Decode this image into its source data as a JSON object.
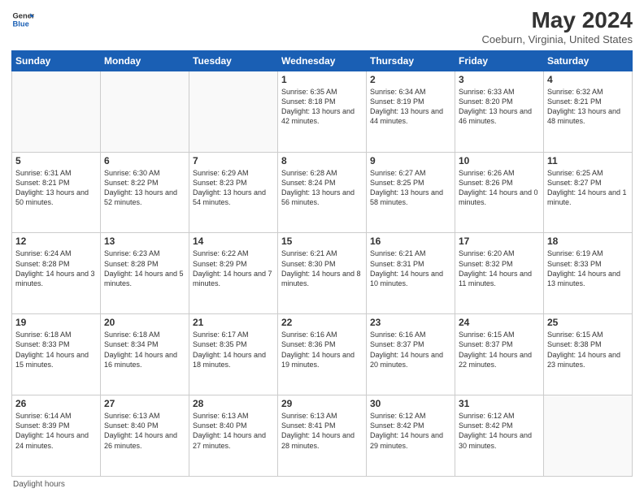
{
  "header": {
    "logo_general": "General",
    "logo_blue": "Blue",
    "title": "May 2024",
    "subtitle": "Coeburn, Virginia, United States"
  },
  "weekdays": [
    "Sunday",
    "Monday",
    "Tuesday",
    "Wednesday",
    "Thursday",
    "Friday",
    "Saturday"
  ],
  "weeks": [
    [
      {
        "day": "",
        "info": ""
      },
      {
        "day": "",
        "info": ""
      },
      {
        "day": "",
        "info": ""
      },
      {
        "day": "1",
        "info": "Sunrise: 6:35 AM\nSunset: 8:18 PM\nDaylight: 13 hours\nand 42 minutes."
      },
      {
        "day": "2",
        "info": "Sunrise: 6:34 AM\nSunset: 8:19 PM\nDaylight: 13 hours\nand 44 minutes."
      },
      {
        "day": "3",
        "info": "Sunrise: 6:33 AM\nSunset: 8:20 PM\nDaylight: 13 hours\nand 46 minutes."
      },
      {
        "day": "4",
        "info": "Sunrise: 6:32 AM\nSunset: 8:21 PM\nDaylight: 13 hours\nand 48 minutes."
      }
    ],
    [
      {
        "day": "5",
        "info": "Sunrise: 6:31 AM\nSunset: 8:21 PM\nDaylight: 13 hours\nand 50 minutes."
      },
      {
        "day": "6",
        "info": "Sunrise: 6:30 AM\nSunset: 8:22 PM\nDaylight: 13 hours\nand 52 minutes."
      },
      {
        "day": "7",
        "info": "Sunrise: 6:29 AM\nSunset: 8:23 PM\nDaylight: 13 hours\nand 54 minutes."
      },
      {
        "day": "8",
        "info": "Sunrise: 6:28 AM\nSunset: 8:24 PM\nDaylight: 13 hours\nand 56 minutes."
      },
      {
        "day": "9",
        "info": "Sunrise: 6:27 AM\nSunset: 8:25 PM\nDaylight: 13 hours\nand 58 minutes."
      },
      {
        "day": "10",
        "info": "Sunrise: 6:26 AM\nSunset: 8:26 PM\nDaylight: 14 hours\nand 0 minutes."
      },
      {
        "day": "11",
        "info": "Sunrise: 6:25 AM\nSunset: 8:27 PM\nDaylight: 14 hours\nand 1 minute."
      }
    ],
    [
      {
        "day": "12",
        "info": "Sunrise: 6:24 AM\nSunset: 8:28 PM\nDaylight: 14 hours\nand 3 minutes."
      },
      {
        "day": "13",
        "info": "Sunrise: 6:23 AM\nSunset: 8:28 PM\nDaylight: 14 hours\nand 5 minutes."
      },
      {
        "day": "14",
        "info": "Sunrise: 6:22 AM\nSunset: 8:29 PM\nDaylight: 14 hours\nand 7 minutes."
      },
      {
        "day": "15",
        "info": "Sunrise: 6:21 AM\nSunset: 8:30 PM\nDaylight: 14 hours\nand 8 minutes."
      },
      {
        "day": "16",
        "info": "Sunrise: 6:21 AM\nSunset: 8:31 PM\nDaylight: 14 hours\nand 10 minutes."
      },
      {
        "day": "17",
        "info": "Sunrise: 6:20 AM\nSunset: 8:32 PM\nDaylight: 14 hours\nand 11 minutes."
      },
      {
        "day": "18",
        "info": "Sunrise: 6:19 AM\nSunset: 8:33 PM\nDaylight: 14 hours\nand 13 minutes."
      }
    ],
    [
      {
        "day": "19",
        "info": "Sunrise: 6:18 AM\nSunset: 8:33 PM\nDaylight: 14 hours\nand 15 minutes."
      },
      {
        "day": "20",
        "info": "Sunrise: 6:18 AM\nSunset: 8:34 PM\nDaylight: 14 hours\nand 16 minutes."
      },
      {
        "day": "21",
        "info": "Sunrise: 6:17 AM\nSunset: 8:35 PM\nDaylight: 14 hours\nand 18 minutes."
      },
      {
        "day": "22",
        "info": "Sunrise: 6:16 AM\nSunset: 8:36 PM\nDaylight: 14 hours\nand 19 minutes."
      },
      {
        "day": "23",
        "info": "Sunrise: 6:16 AM\nSunset: 8:37 PM\nDaylight: 14 hours\nand 20 minutes."
      },
      {
        "day": "24",
        "info": "Sunrise: 6:15 AM\nSunset: 8:37 PM\nDaylight: 14 hours\nand 22 minutes."
      },
      {
        "day": "25",
        "info": "Sunrise: 6:15 AM\nSunset: 8:38 PM\nDaylight: 14 hours\nand 23 minutes."
      }
    ],
    [
      {
        "day": "26",
        "info": "Sunrise: 6:14 AM\nSunset: 8:39 PM\nDaylight: 14 hours\nand 24 minutes."
      },
      {
        "day": "27",
        "info": "Sunrise: 6:13 AM\nSunset: 8:40 PM\nDaylight: 14 hours\nand 26 minutes."
      },
      {
        "day": "28",
        "info": "Sunrise: 6:13 AM\nSunset: 8:40 PM\nDaylight: 14 hours\nand 27 minutes."
      },
      {
        "day": "29",
        "info": "Sunrise: 6:13 AM\nSunset: 8:41 PM\nDaylight: 14 hours\nand 28 minutes."
      },
      {
        "day": "30",
        "info": "Sunrise: 6:12 AM\nSunset: 8:42 PM\nDaylight: 14 hours\nand 29 minutes."
      },
      {
        "day": "31",
        "info": "Sunrise: 6:12 AM\nSunset: 8:42 PM\nDaylight: 14 hours\nand 30 minutes."
      },
      {
        "day": "",
        "info": ""
      }
    ]
  ],
  "footer": {
    "note": "Daylight hours"
  }
}
